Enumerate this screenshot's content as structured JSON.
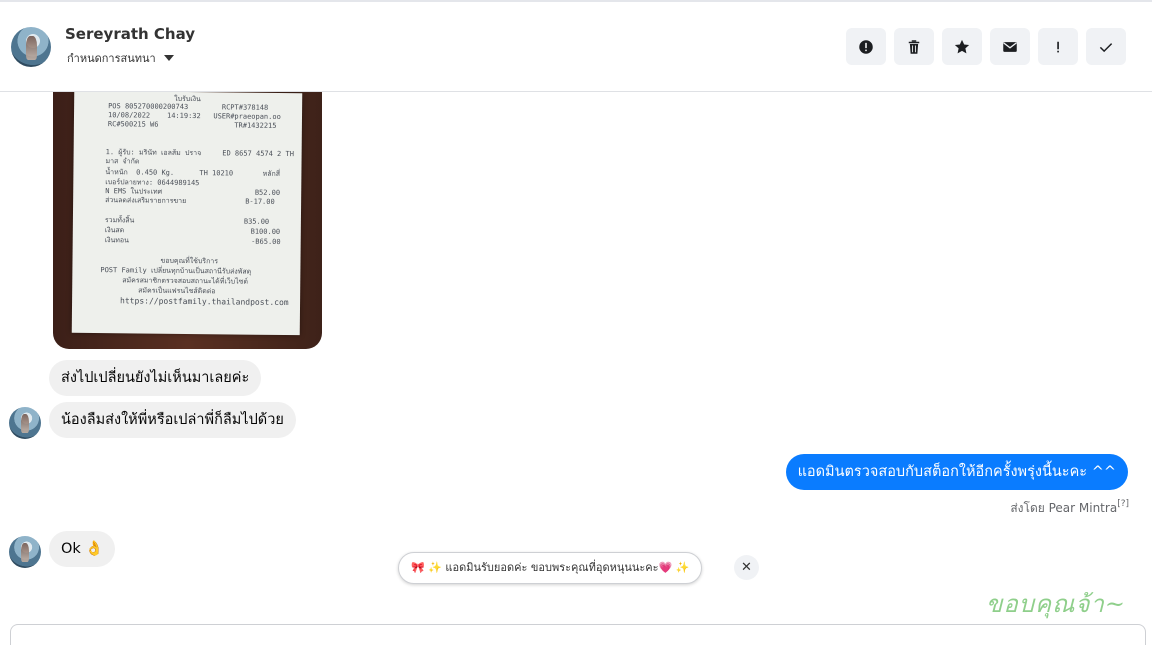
{
  "header": {
    "contact_name": "Sereyrath Chay",
    "assign_label": "กำหนดการสนทนา"
  },
  "actions": [
    {
      "name": "report-button",
      "icon": "alert-circle-icon"
    },
    {
      "name": "delete-button",
      "icon": "trash-icon"
    },
    {
      "name": "star-button",
      "icon": "star-icon"
    },
    {
      "name": "mark-unread-button",
      "icon": "envelope-icon"
    },
    {
      "name": "important-button",
      "icon": "exclamation-icon"
    },
    {
      "name": "done-button",
      "icon": "check-icon"
    }
  ],
  "receipt": {
    "lines": [
      "ใบรับเงิน",
      "POS 805270000200743        RCPT#378148",
      "10/08/2022    14:19:32   USER#praeopan.oo",
      "RC#500215 W6                  TR#1432215",
      "1. ผู้รับ: มรินัท เอลส้ม ปราจ     ED 8657 4574 2 TH",
      "มาส จำกัด",
      "น้ำหนัก  0.450 Kg.      TH 10210       หลักสี่",
      "เบอร์ปลายทาง: 0644989145",
      "N EMS ในประเทศ                      B52.00",
      "ส่วนลดส่งเสริมรายการขาย              B-17.00",
      "รวมทั้งสิ้น                          B35.00",
      "เงินสด                              B100.00",
      "เงินทอน                             -B65.00",
      "ขอบคุณที่ใช้บริการ",
      "POST Family เปลี่ยนทุกบ้านเป็นสถานีรับส่งพัสดุ",
      "สมัครสมาชิกตรวจสอบสถานะได้ที่เว็บไซต์",
      "สมัครเป็นแฟรนไชส์ติดต่อ",
      "https://postfamily.thailandpost.com"
    ]
  },
  "messages": {
    "in1": "ส่งไปเปลี่ยนยังไม่เห็นมาเลยค่ะ",
    "in2": "น้องลืมส่งให้พี่หรือเปล่าพี่ก็ลืมไปด้วย",
    "out1": "แอดมินตรวจสอบกับสต็อกให้อีกครั้งพรุ่งนี้นะคะ ^^",
    "sent_by": "ส่งโดย Pear Mintra",
    "sent_by_help": "[?]",
    "in3": "Ok 👌"
  },
  "quick_reply": {
    "text": "🎀 ✨ แอดมินรับยอดค่ะ ขอบพระคุณที่อุดหนุนนะคะ💗 ✨",
    "close_glyph": "✕"
  },
  "sticker_text": "ขอบคุณจ้า~",
  "colors": {
    "accent_blue": "#0a7cff",
    "incoming_bubble": "#f0f0f0",
    "action_bg": "#f0f2f5"
  }
}
